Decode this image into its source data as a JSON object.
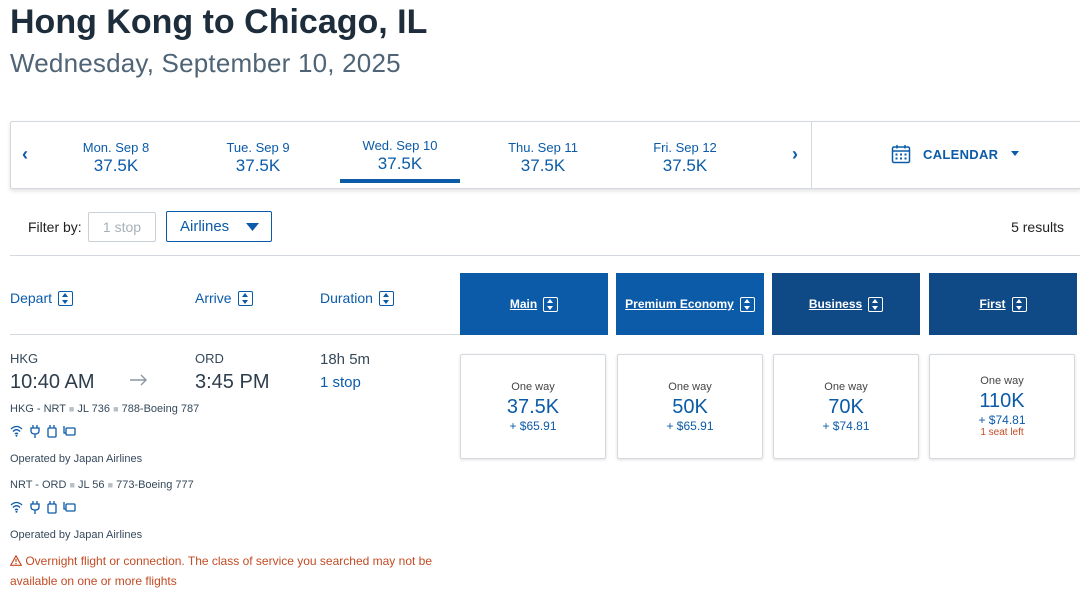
{
  "header": {
    "title": "Hong Kong to Chicago, IL",
    "date": "Wednesday, September 10, 2025"
  },
  "date_strip": {
    "prev": "‹",
    "next": "›",
    "dates": [
      {
        "label": "Mon. Sep 8",
        "price": "37.5K"
      },
      {
        "label": "Tue. Sep 9",
        "price": "37.5K"
      },
      {
        "label": "Wed. Sep 10",
        "price": "37.5K",
        "selected": true
      },
      {
        "label": "Thu. Sep 11",
        "price": "37.5K"
      },
      {
        "label": "Fri. Sep 12",
        "price": "37.5K"
      }
    ],
    "calendar_label": "CALENDAR"
  },
  "filters": {
    "label": "Filter by:",
    "stops": "1 stop",
    "airlines": "Airlines",
    "results": "5 results"
  },
  "columns": {
    "depart": "Depart",
    "arrive": "Arrive",
    "duration": "Duration"
  },
  "cabins": [
    {
      "name": "Main",
      "color": "#0b5ba8"
    },
    {
      "name": "Premium Economy",
      "color": "#0b5ba8"
    },
    {
      "name": "Business",
      "color": "#0f4a86"
    },
    {
      "name": "First",
      "color": "#0f4a86"
    }
  ],
  "flight": {
    "depart_airport": "HKG",
    "depart_time": "10:40 AM",
    "arrive_airport": "ORD",
    "arrive_time": "3:45 PM",
    "duration": "18h 5m",
    "stops": "1 stop",
    "segments": [
      {
        "route": "HKG - NRT",
        "flight": "JL 736",
        "aircraft": "788-Boeing 787",
        "operator": "Operated by Japan Airlines"
      },
      {
        "route": "NRT - ORD",
        "flight": "JL 56",
        "aircraft": "773-Boeing 777",
        "operator": "Operated by Japan Airlines"
      }
    ],
    "warning": "Overnight flight or connection. The class of service you searched may not be available on one or more flights"
  },
  "prices": [
    {
      "label": "One way",
      "miles": "37.5K",
      "tax": "+ $65.91"
    },
    {
      "label": "One way",
      "miles": "50K",
      "tax": "+ $65.91"
    },
    {
      "label": "One way",
      "miles": "70K",
      "tax": "+ $74.81"
    },
    {
      "label": "One way",
      "miles": "110K",
      "tax": "+ $74.81",
      "seats": "1 seat left"
    }
  ],
  "colors": {
    "accent": "#0b5ba8",
    "cabin_dark": "#0f4a86",
    "warning": "#c24b24"
  }
}
